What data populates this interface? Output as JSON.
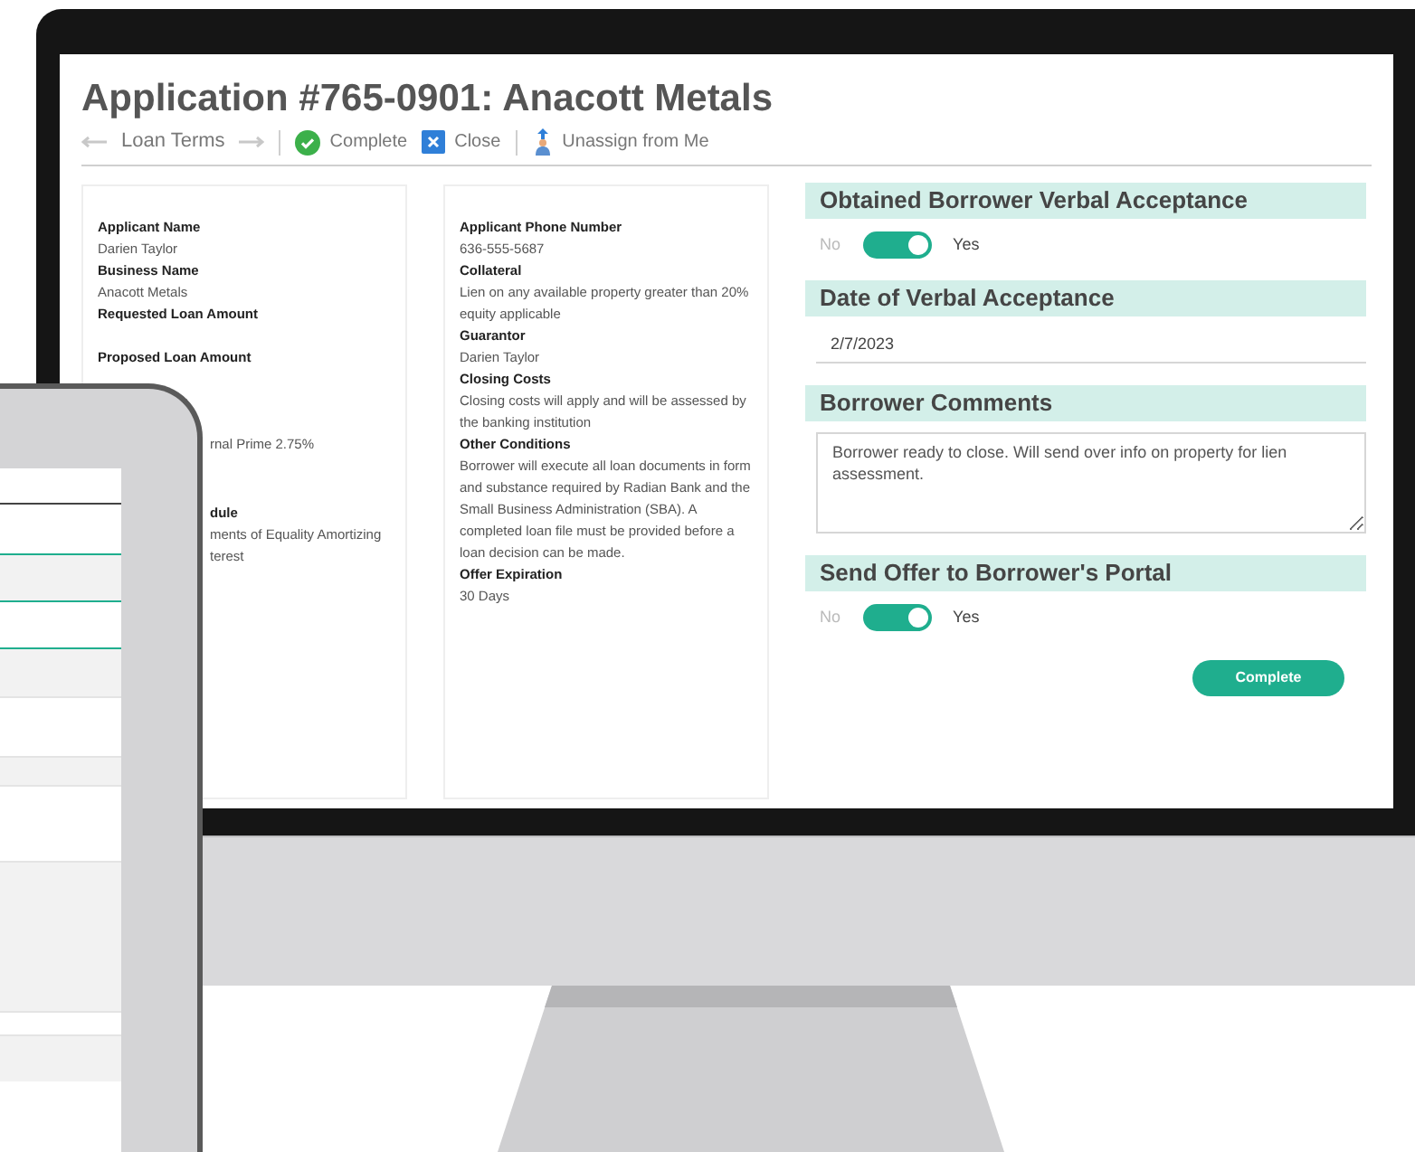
{
  "title": "Application #765-0901: Anacott Metals",
  "toolbar": {
    "step": "Loan Terms",
    "actions": [
      {
        "kind": "complete",
        "label": "Complete"
      },
      {
        "kind": "close",
        "label": "Close"
      },
      {
        "kind": "unassign",
        "label": "Unassign from Me"
      }
    ]
  },
  "summary_cards": [
    {
      "fields": [
        {
          "label": "Applicant Name",
          "value": "Darien Taylor"
        },
        {
          "label": "Business Name",
          "value": "Anacott Metals"
        },
        {
          "label": "Requested Loan Amount"
        },
        {
          "label": "Proposed Loan Amount"
        }
      ],
      "partial_lines": [
        {
          "text": "rnal Prime 2.75%",
          "bold": false
        },
        {
          "text": "dule",
          "bold": true
        },
        {
          "text": "ments of Equality Amortizing",
          "bold": false
        },
        {
          "text": "terest",
          "bold": false
        }
      ]
    },
    {
      "fields": [
        {
          "label": "Applicant Phone Number",
          "value": "636-555-5687"
        },
        {
          "label": "Collateral",
          "value": "Lien on any available property greater than 20% equity applicable"
        },
        {
          "label": "Guarantor",
          "value": "Darien Taylor"
        },
        {
          "label": "Closing Costs",
          "value": "Closing costs will apply and will be assessed by the banking institution"
        },
        {
          "label": "Other Conditions",
          "value": "Borrower will execute all loan documents in form and substance required by Radian Bank and the Small Business Administration (SBA). A completed loan file must be provided before a loan decision can be made."
        },
        {
          "label": "Offer Expiration",
          "value": "30 Days"
        }
      ]
    }
  ],
  "sections": [
    {
      "kind": "toggle",
      "heading": "Obtained Borrower Verbal Acceptance",
      "off_label": "No",
      "on_label": "Yes",
      "on": true
    },
    {
      "kind": "date",
      "heading": "Date of Verbal Acceptance",
      "value": "2/7/2023"
    },
    {
      "kind": "textarea",
      "heading": "Borrower Comments",
      "value": "Borrower ready to close. Will send over info on property for lien assessment."
    },
    {
      "kind": "toggle",
      "heading": "Send Offer to Borrower's Portal",
      "off_label": "No",
      "on_label": "Yes",
      "on": true
    }
  ],
  "submit_button": "Complete"
}
